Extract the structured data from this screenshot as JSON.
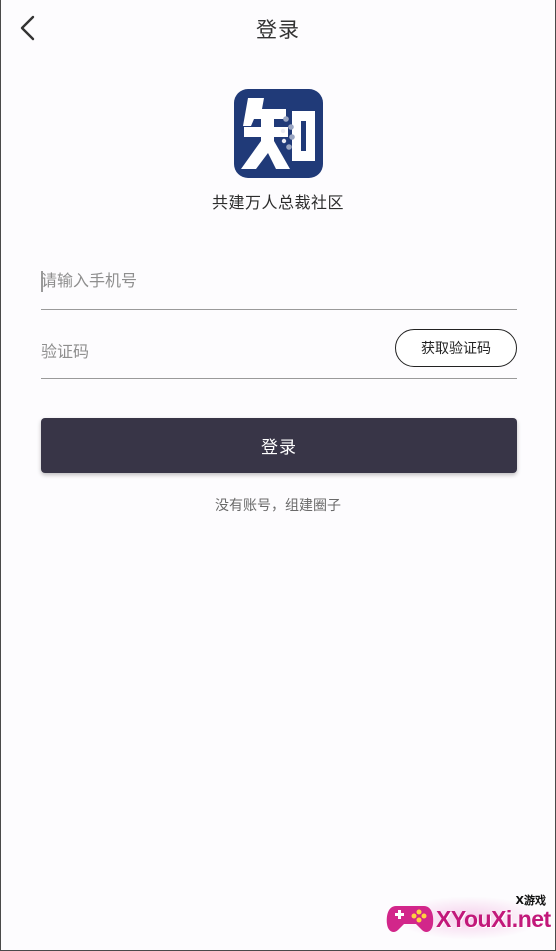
{
  "header": {
    "title": "登录",
    "back_icon": "chevron-left-icon"
  },
  "brand": {
    "logo_char": "知",
    "logo_bg": "#203a78",
    "slogan": "共建万人总裁社区"
  },
  "form": {
    "phone_placeholder": "请输入手机号",
    "code_placeholder": "验证码",
    "get_code_label": "获取验证码"
  },
  "actions": {
    "login_label": "登录",
    "login_bg": "#383547",
    "register_link": "没有账号，组建圈子"
  },
  "watermark": {
    "small_text": "X游戏",
    "text": "XYouXi.net",
    "accent": "#c2187a"
  }
}
